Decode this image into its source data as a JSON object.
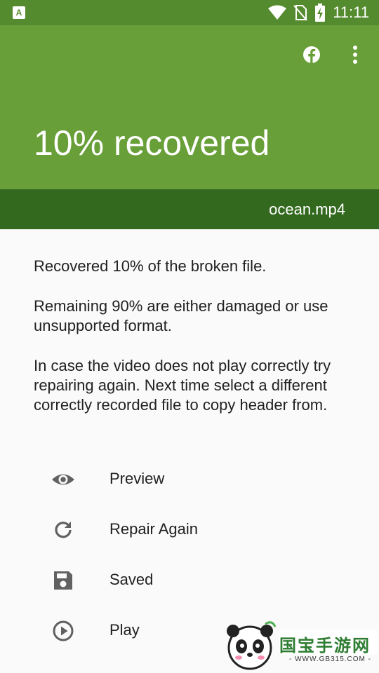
{
  "status_bar": {
    "left_badge": "A",
    "time": "11:11"
  },
  "header": {
    "title": "10% recovered",
    "icons": [
      "facebook-icon",
      "more-vert-icon"
    ]
  },
  "file": {
    "name": "ocean.mp4"
  },
  "message": {
    "line1": "Recovered 10% of the broken file.",
    "line2": "Remaining 90% are either damaged or use unsupported format.",
    "line3": "In case the video does not play correctly try repairing again. Next time select a different correctly recorded file to copy header from."
  },
  "actions": [
    {
      "label": "Preview",
      "icon": "eye-icon"
    },
    {
      "label": "Repair Again",
      "icon": "refresh-icon"
    },
    {
      "label": "Saved",
      "icon": "save-icon"
    },
    {
      "label": "Play",
      "icon": "play-circle-icon"
    }
  ],
  "watermark": {
    "text": "国宝手游网",
    "sub": "- WWW.GB315.COM -"
  },
  "colors": {
    "status_bar": "#558b2f",
    "app_bar": "#689f38",
    "file_bar": "#33691e",
    "icon": "#616161"
  }
}
